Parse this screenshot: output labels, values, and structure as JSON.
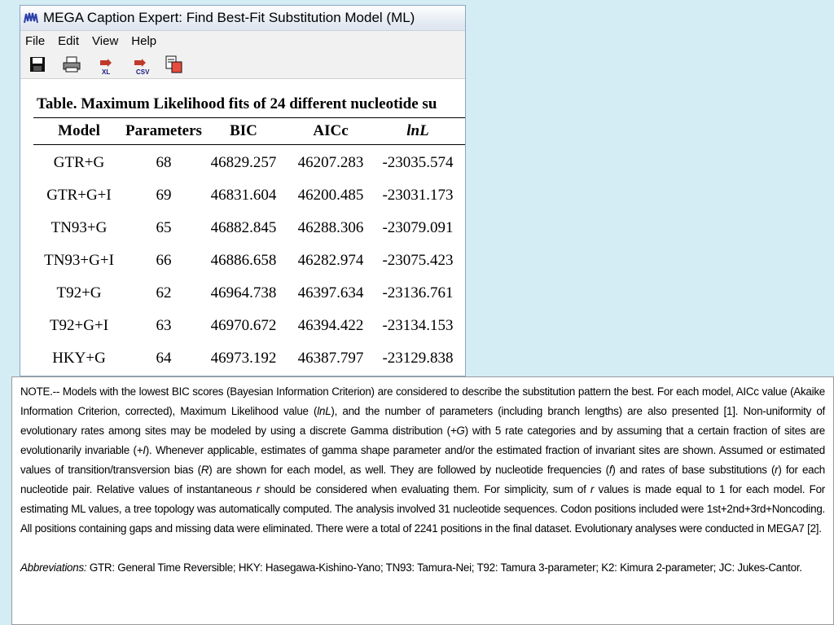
{
  "window": {
    "title": "MEGA Caption Expert: Find Best-Fit Substitution Model (ML)",
    "icon": "mega-logo-icon"
  },
  "menu": [
    "File",
    "Edit",
    "View",
    "Help"
  ],
  "toolbar": {
    "tools": [
      {
        "icon": "save-icon",
        "label": ""
      },
      {
        "icon": "print-icon",
        "label": ""
      },
      {
        "icon": "export-excel-icon",
        "label": "XL"
      },
      {
        "icon": "export-csv-icon",
        "label": "CSV"
      },
      {
        "icon": "copy-icon",
        "label": ""
      }
    ]
  },
  "caption": "Table. Maximum Likelihood fits of 24 different nucleotide su",
  "table": {
    "headers": [
      "Model",
      "Parameters",
      "BIC",
      "AICc",
      "lnL"
    ],
    "rows": [
      [
        "GTR+G",
        "68",
        "46829.257",
        "46207.283",
        "-23035.574"
      ],
      [
        "GTR+G+I",
        "69",
        "46831.604",
        "46200.485",
        "-23031.173"
      ],
      [
        "TN93+G",
        "65",
        "46882.845",
        "46288.306",
        "-23079.091"
      ],
      [
        "TN93+G+I",
        "66",
        "46886.658",
        "46282.974",
        "-23075.423"
      ],
      [
        "T92+G",
        "62",
        "46964.738",
        "46397.634",
        "-23136.761"
      ],
      [
        "T92+G+I",
        "63",
        "46970.672",
        "46394.422",
        "-23134.153"
      ],
      [
        "HKY+G",
        "64",
        "46973.192",
        "46387.797",
        "-23129.838"
      ]
    ]
  },
  "note": {
    "parts": [
      {
        "t": "NOTE.-- Models with the lowest BIC scores (Bayesian Information Criterion) are considered to describe the substitution pattern the best. For each model, AICc value (Akaike Information Criterion, corrected), Maximum Likelihood value (",
        "i": false
      },
      {
        "t": "lnL",
        "i": true
      },
      {
        "t": "), and the number of parameters (including branch lengths) are also presented [1]. Non-uniformity of evolutionary rates among sites may be modeled by using a discrete Gamma distribution (",
        "i": false
      },
      {
        "t": "+G",
        "i": true
      },
      {
        "t": ") with 5 rate categories and by assuming that a certain fraction of sites are evolutionarily invariable (",
        "i": false
      },
      {
        "t": "+I",
        "i": true
      },
      {
        "t": "). Whenever applicable, estimates of gamma shape parameter and/or the estimated fraction of invariant sites are shown. Assumed or estimated values of transition/transversion bias (",
        "i": false
      },
      {
        "t": "R",
        "i": true
      },
      {
        "t": ") are shown for each model, as well. They are followed by nucleotide frequencies (",
        "i": false
      },
      {
        "t": "f",
        "i": true
      },
      {
        "t": ") and rates of base substitutions (",
        "i": false
      },
      {
        "t": "r",
        "i": true
      },
      {
        "t": ") for each nucleotide pair. Relative values of instantaneous ",
        "i": false
      },
      {
        "t": "r",
        "i": true
      },
      {
        "t": " should be considered when evaluating them. For simplicity, sum of ",
        "i": false
      },
      {
        "t": "r",
        "i": true
      },
      {
        "t": " values is made equal to 1 for each model. For estimating ML values, a tree topology was automatically computed. The analysis involved 31 nucleotide sequences. Codon positions included were 1st+2nd+3rd+Noncoding. All positions containing gaps and missing data were eliminated. There were a total of 2241 positions in the final dataset. Evolutionary analyses were conducted in MEGA7 [2].",
        "i": false
      }
    ],
    "abbrev_label": "Abbreviations:",
    "abbrev_text": " GTR: General Time Reversible; HKY: Hasegawa-Kishino-Yano; TN93: Tamura-Nei; T92: Tamura 3-parameter; K2: Kimura 2-parameter; JC: Jukes-Cantor."
  }
}
